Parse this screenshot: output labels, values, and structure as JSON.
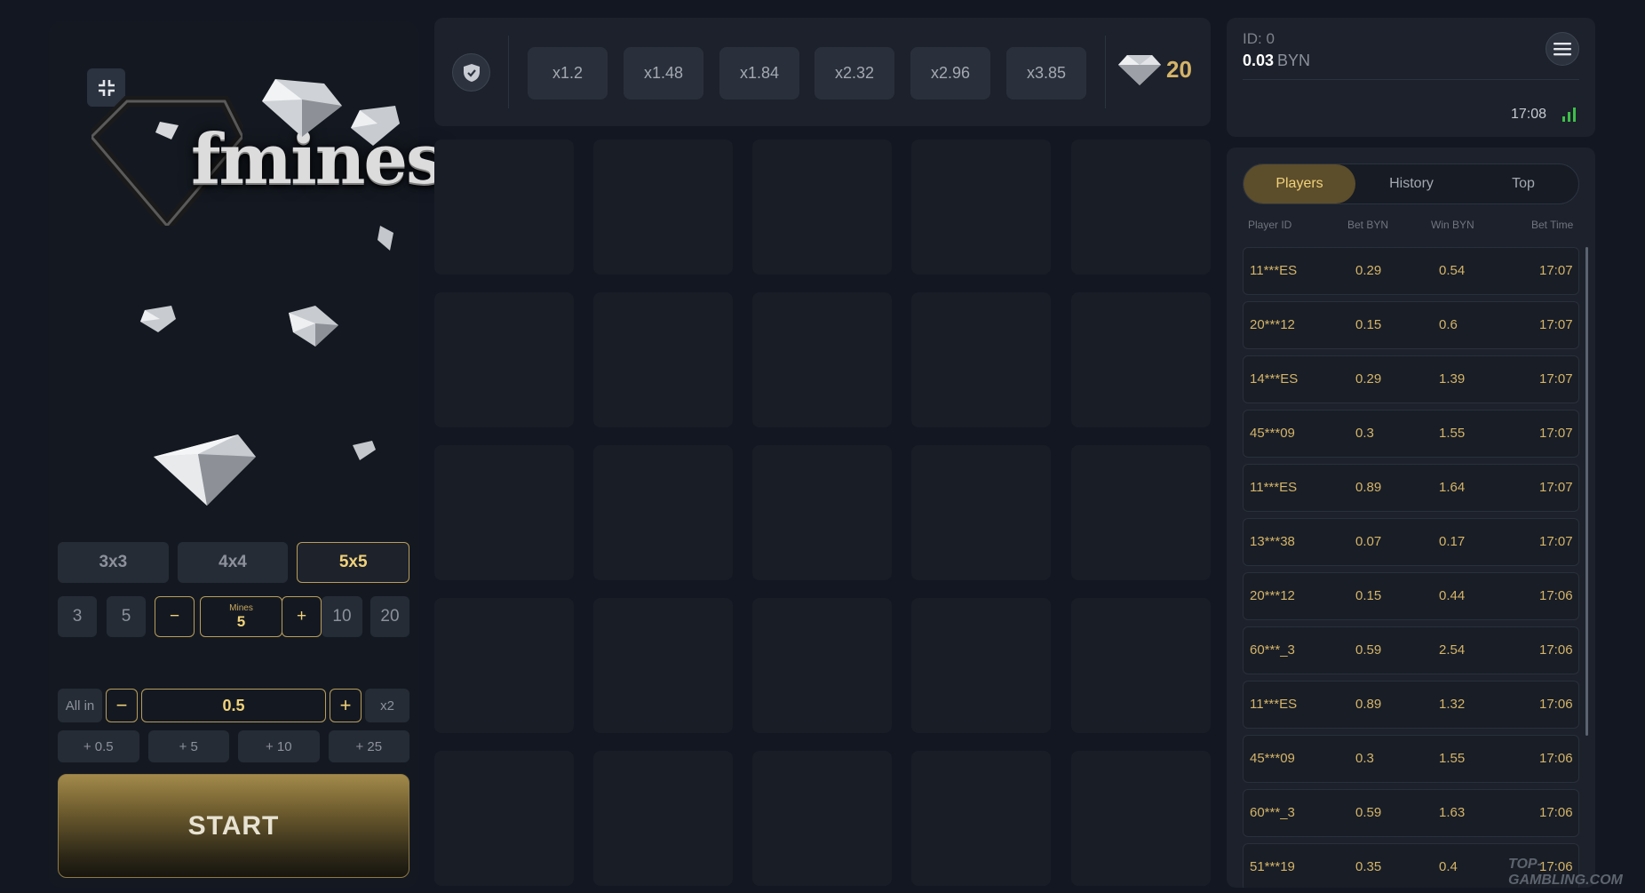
{
  "logo": {
    "text": "fmines"
  },
  "grid_sizes": [
    {
      "label": "3x3",
      "active": false
    },
    {
      "label": "4x4",
      "active": false
    },
    {
      "label": "5x5",
      "active": true
    }
  ],
  "mines": {
    "preset_1": "3",
    "preset_2": "5",
    "minus": "−",
    "label": "Mines",
    "value": "5",
    "plus": "+",
    "preset_3": "10",
    "preset_4": "20"
  },
  "bet": {
    "all_in": "All in",
    "minus": "−",
    "value": "0.5",
    "plus": "+",
    "double": "x2",
    "add_buttons": [
      "+ 0.5",
      "+ 5",
      "+ 10",
      "+ 25"
    ]
  },
  "start_label": "START",
  "multipliers": [
    "x1.2",
    "x1.48",
    "x1.84",
    "x2.32",
    "x2.96",
    "x3.85"
  ],
  "gem_count": "20",
  "account": {
    "id_label": "ID: 0",
    "balance": "0.03",
    "currency": "BYN",
    "time": "17:08"
  },
  "tabs": [
    {
      "label": "Players",
      "active": true
    },
    {
      "label": "History",
      "active": false
    },
    {
      "label": "Top",
      "active": false
    }
  ],
  "table_headers": {
    "player": "Player ID",
    "bet": "Bet  BYN",
    "win": "Win  BYN",
    "time": "Bet Time"
  },
  "players": [
    {
      "id": "11***ES",
      "bet": "0.29",
      "win": "0.54",
      "time": "17:07"
    },
    {
      "id": "20***12",
      "bet": "0.15",
      "win": "0.6",
      "time": "17:07"
    },
    {
      "id": "14***ES",
      "bet": "0.29",
      "win": "1.39",
      "time": "17:07"
    },
    {
      "id": "45***09",
      "bet": "0.3",
      "win": "1.55",
      "time": "17:07"
    },
    {
      "id": "11***ES",
      "bet": "0.89",
      "win": "1.64",
      "time": "17:07"
    },
    {
      "id": "13***38",
      "bet": "0.07",
      "win": "0.17",
      "time": "17:07"
    },
    {
      "id": "20***12",
      "bet": "0.15",
      "win": "0.44",
      "time": "17:06"
    },
    {
      "id": "60***_3",
      "bet": "0.59",
      "win": "2.54",
      "time": "17:06"
    },
    {
      "id": "11***ES",
      "bet": "0.89",
      "win": "1.32",
      "time": "17:06"
    },
    {
      "id": "45***09",
      "bet": "0.3",
      "win": "1.55",
      "time": "17:06"
    },
    {
      "id": "60***_3",
      "bet": "0.59",
      "win": "1.63",
      "time": "17:06"
    },
    {
      "id": "51***19",
      "bet": "0.35",
      "win": "0.4",
      "time": "17:06"
    }
  ],
  "watermark": "TOP-GAMBLING.COM",
  "colors": {
    "background": "#121722",
    "panel": "#1c212b",
    "tile": "#181d26",
    "gold": "#d5b468",
    "gold_border": "#b99d5b",
    "signal": "#3fbf4a"
  }
}
